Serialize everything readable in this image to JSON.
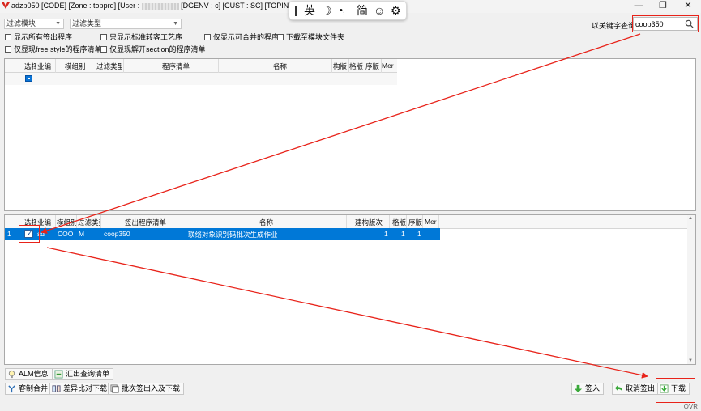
{
  "window": {
    "title_part1": "adzp050 [CODE]  [Zone : topprd]  [User :",
    "title_part2": "[DGENV : c]   [CUST : SC]   [TOPIND : sd]   [TC",
    "minimize": "—",
    "maximize": "❐",
    "close": "✕"
  },
  "ime": {
    "lang": "英",
    "moon": "☽",
    "punct": "•,",
    "simp": "简",
    "emoji": "☺",
    "settings": "⚙"
  },
  "filters": {
    "module_placeholder": "过滤模块",
    "type_placeholder": "过滤类型",
    "search_label": "以关键字查询",
    "search_value": "coop350"
  },
  "options": {
    "show_all_checkout": "显示所有签出程序",
    "only_standard_tailor": "只显示标准转客工艺序",
    "only_mergeable": "仅显示可合并的程序",
    "download_to_module": "下载至模块文件夹",
    "only_free_style": "仅显现free style的程序清单",
    "only_section": "仅显现解开section的程序清单"
  },
  "grid_top": {
    "headers": [
      "选择",
      "业编",
      "模组别",
      "过滤类型",
      "程序清单",
      "名称",
      "构版",
      "格版",
      "序版",
      "Mer"
    ]
  },
  "grid_bottom": {
    "headers": [
      "选择",
      "业编",
      "模组别",
      "过滤类型",
      "签出程序清单",
      "名称",
      "建构版次",
      "格版",
      "序版",
      "Mer"
    ],
    "rows": [
      {
        "num": "1",
        "checked": "✓",
        "code": "sd",
        "module": "COO",
        "type": "M",
        "program": "coop350",
        "name": "联络对象识别码批次生成作业",
        "build": "1",
        "grid": "1",
        "seq": "1"
      }
    ]
  },
  "buttons": {
    "alm": "ALM信息",
    "export_query": "汇出查询清单",
    "custom_merge": "客制合并",
    "diff_download": "差异比对下载",
    "batch_checkin_download": "批次签出入及下载",
    "checkin": "签入",
    "cancel_checkout": "取消签出",
    "download": "下载"
  },
  "status": {
    "ovr": "OVR"
  },
  "colors": {
    "selected_row": "#0078d7",
    "annotation_red": "#e8231a"
  }
}
